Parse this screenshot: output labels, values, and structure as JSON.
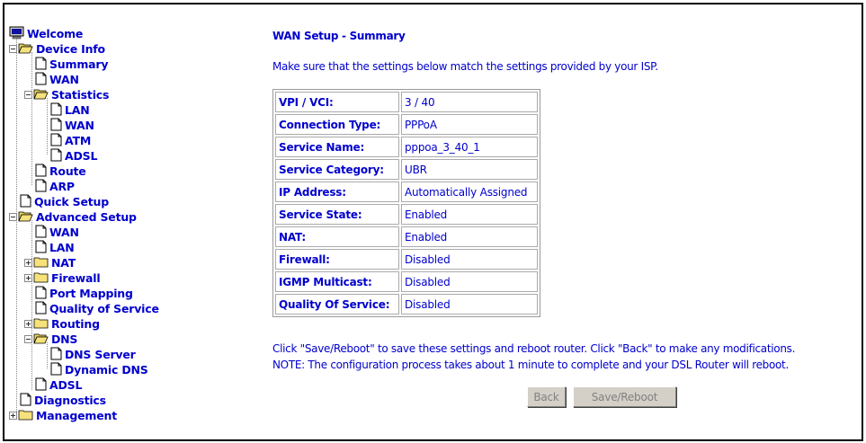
{
  "tree": {
    "welcome": "Welcome",
    "device_info": "Device Info",
    "summary": "Summary",
    "wan": "WAN",
    "statistics": "Statistics",
    "stat_lan": "LAN",
    "stat_wan": "WAN",
    "stat_atm": "ATM",
    "stat_adsl": "ADSL",
    "route": "Route",
    "arp": "ARP",
    "quick_setup": "Quick Setup",
    "advanced_setup": "Advanced Setup",
    "adv_wan": "WAN",
    "adv_lan": "LAN",
    "nat": "NAT",
    "firewall": "Firewall",
    "port_mapping": "Port Mapping",
    "qos": "Quality of Service",
    "routing": "Routing",
    "dns": "DNS",
    "dns_server": "DNS Server",
    "dynamic_dns": "Dynamic DNS",
    "adv_adsl": "ADSL",
    "diagnostics": "Diagnostics",
    "management": "Management"
  },
  "main": {
    "title": "WAN Setup - Summary",
    "intro": "Make sure that the settings below match the settings provided by your ISP.",
    "rows": [
      {
        "label": "VPI / VCI:",
        "value": "3 / 40"
      },
      {
        "label": "Connection Type:",
        "value": "PPPoA"
      },
      {
        "label": "Service Name:",
        "value": "pppoa_3_40_1"
      },
      {
        "label": "Service Category:",
        "value": "UBR"
      },
      {
        "label": "IP Address:",
        "value": "Automatically Assigned"
      },
      {
        "label": "Service State:",
        "value": "Enabled"
      },
      {
        "label": "NAT:",
        "value": "Enabled"
      },
      {
        "label": "Firewall:",
        "value": "Disabled"
      },
      {
        "label": "IGMP Multicast:",
        "value": "Disabled"
      },
      {
        "label": "Quality Of Service:",
        "value": "Disabled"
      }
    ],
    "note1": "Click \"Save/Reboot\" to save these settings and reboot router. Click \"Back\" to make any modifications.",
    "note2": "NOTE: The configuration process takes about 1 minute to complete and your DSL Router will reboot.",
    "back_label": "Back",
    "save_label": "Save/Reboot"
  }
}
